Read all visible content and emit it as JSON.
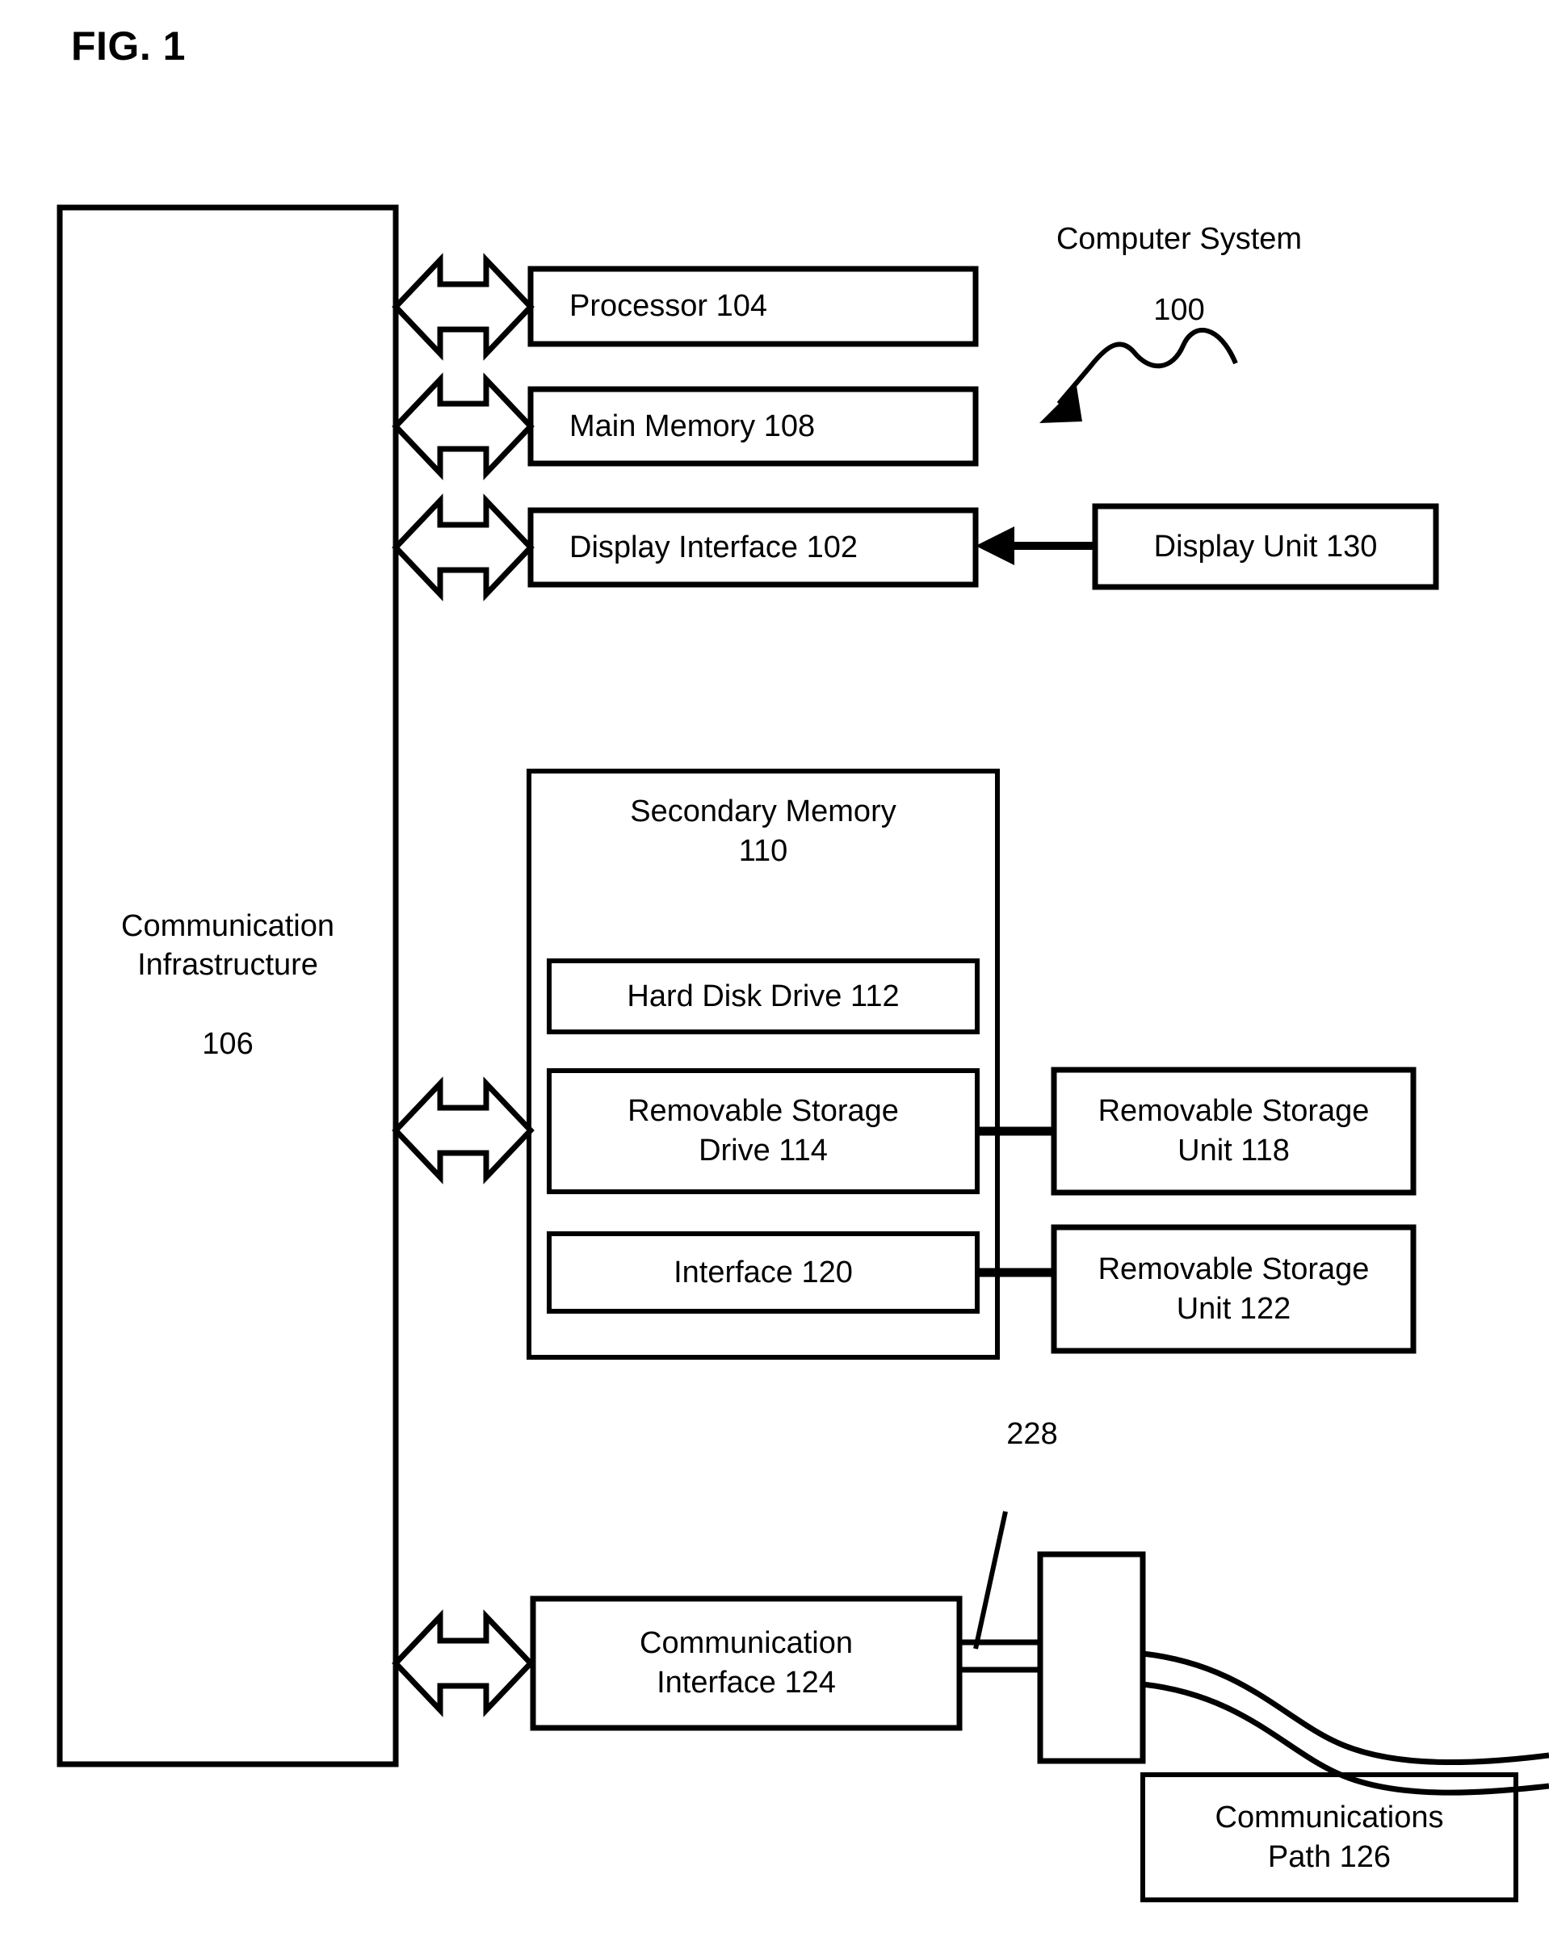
{
  "figure": {
    "title": "FIG. 1",
    "type": "patent-block-diagram"
  },
  "annotations": {
    "computer_system_label": "Computer System",
    "computer_system_ref": "100",
    "connector_ref": "228"
  },
  "blocks": {
    "communication_infrastructure": {
      "name": "Communication\nInfrastructure",
      "ref": "106",
      "text": "Communication\nInfrastructure\n\n106"
    },
    "processor": {
      "text": "Processor 104"
    },
    "main_memory": {
      "text": "Main Memory 108"
    },
    "display_interface": {
      "text": "Display Interface 102"
    },
    "display_unit": {
      "text": "Display Unit 130"
    },
    "secondary_memory": {
      "text": "Secondary Memory\n110"
    },
    "hard_disk_drive": {
      "text": "Hard Disk Drive 112"
    },
    "removable_storage_drive": {
      "text": "Removable Storage\nDrive 114"
    },
    "removable_storage_unit_118": {
      "text": "Removable Storage\nUnit 118"
    },
    "interface_120": {
      "text": "Interface 120"
    },
    "removable_storage_unit_122": {
      "text": "Removable Storage\nUnit 122"
    },
    "communication_interface": {
      "text": "Communication\nInterface 124"
    },
    "connector_block": {
      "text": ""
    },
    "communications_path": {
      "text": "Communications\nPath 126"
    }
  },
  "connections": [
    {
      "from": "communication_infrastructure",
      "to": "processor",
      "style": "double-block-arrow"
    },
    {
      "from": "communication_infrastructure",
      "to": "main_memory",
      "style": "double-block-arrow"
    },
    {
      "from": "communication_infrastructure",
      "to": "display_interface",
      "style": "double-block-arrow"
    },
    {
      "from": "display_unit",
      "to": "display_interface",
      "style": "single-arrow-left"
    },
    {
      "from": "communication_infrastructure",
      "to": "secondary_memory",
      "style": "double-block-arrow"
    },
    {
      "from": "removable_storage_drive",
      "to": "removable_storage_unit_118",
      "style": "plain-line"
    },
    {
      "from": "interface_120",
      "to": "removable_storage_unit_122",
      "style": "plain-line"
    },
    {
      "from": "communication_infrastructure",
      "to": "communication_interface",
      "style": "double-block-arrow"
    },
    {
      "from": "communication_interface",
      "to": "connector_block",
      "style": "double-line"
    },
    {
      "from": "connector_block",
      "to": "communications_path",
      "style": "curved-double-line"
    }
  ],
  "colors": {
    "stroke": "#000000",
    "fill": "#ffffff",
    "background": "#ffffff"
  }
}
